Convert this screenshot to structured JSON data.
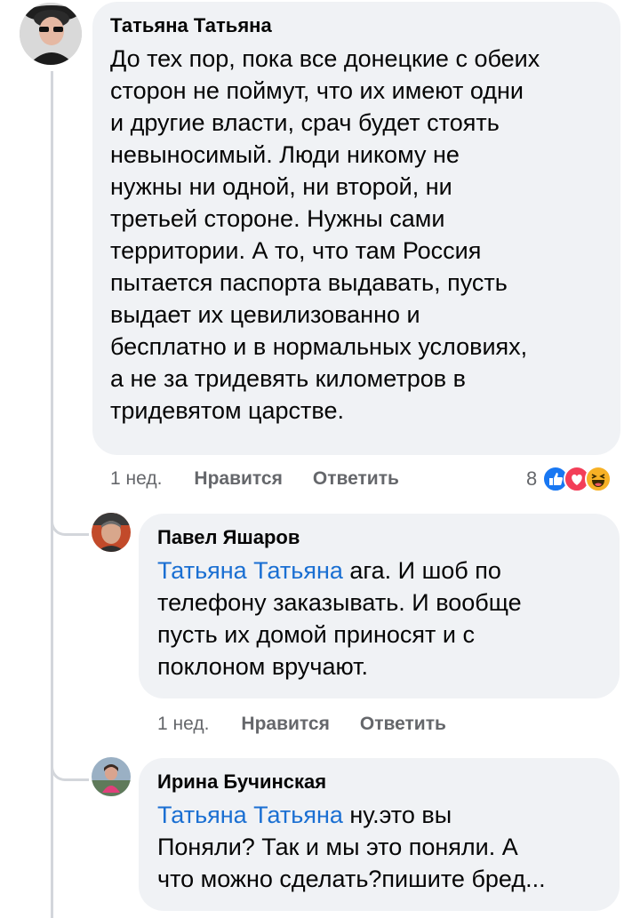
{
  "comments": [
    {
      "author": "Татьяна Татьяна",
      "lines": [
        "До тех пор, пока все донецкие с обеих",
        "сторон не поймут, что их имеют одни",
        "и другие власти, срач будет стоять",
        "невыносимый. Люди никому не",
        "нужны ни одной, ни второй, ни",
        "третьей стороне. Нужны сами",
        "территории. А то, что там Россия",
        "пытается паспорта выдавать, пусть",
        "выдает их цевилизованно и",
        "бесплатно и в нормальных условиях,",
        "а не за тридевять километров в",
        "тридевятом царстве."
      ],
      "time": "1 нед.",
      "like_label": "Нравится",
      "reply_label": "Ответить",
      "reaction_count": "8",
      "reaction_icons": [
        "like-icon",
        "love-icon",
        "haha-icon"
      ]
    },
    {
      "author": "Павел Яшаров",
      "mention": "Татьяна Татьяна",
      "first_rest": " ага. И шоб по",
      "lines": [
        "телефону заказывать. И вообще",
        "пусть их домой приносят и с",
        "поклоном вручают."
      ],
      "time": "1 нед.",
      "like_label": "Нравится",
      "reply_label": "Ответить"
    },
    {
      "author": "Ирина Бучинская",
      "mention": "Татьяна Татьяна",
      "first_rest": " ну.это вы",
      "lines": [
        "Поняли? Так и мы это поняли. А",
        "что можно сделать?пишите бред..."
      ]
    }
  ],
  "colors": {
    "bubble": "#f0f2f5",
    "mention": "#1a6fd2",
    "meta": "#65676b",
    "like": "#1877f2",
    "love": "#f33e58",
    "haha": "#f7b125"
  }
}
